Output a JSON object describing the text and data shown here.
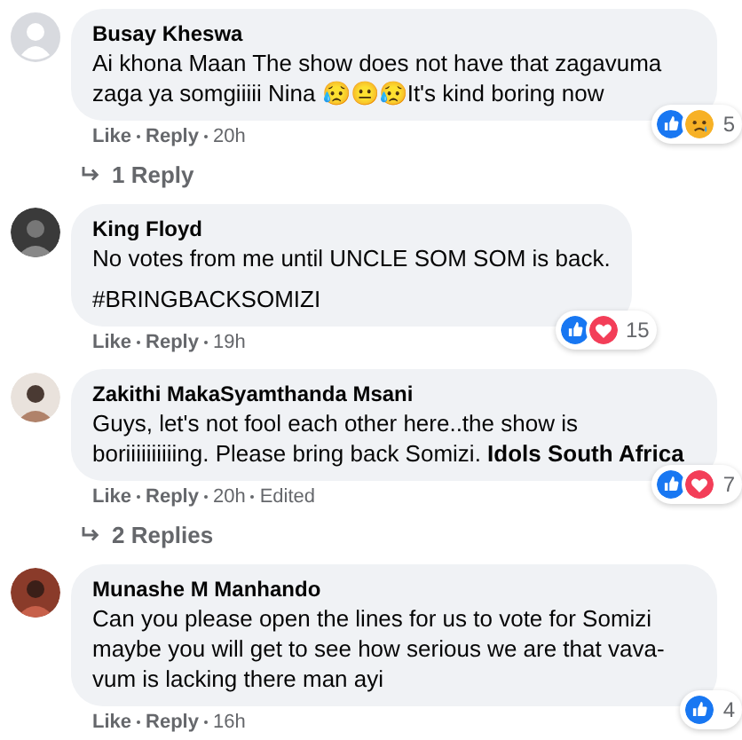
{
  "comments": [
    {
      "author": "Busay Kheswa",
      "avatar": {
        "has_photo": false
      },
      "paragraphs": [
        [
          {
            "kind": "text",
            "text": "Ai khona Maan The show does not have that zagavuma zaga ya somgiiiii Nina 😥😐😥It's kind boring now"
          }
        ]
      ],
      "reactions": {
        "like": true,
        "sad": true
      },
      "reaction_count": "5",
      "actions": [
        "Like",
        "Reply",
        "20h"
      ],
      "replies": "1 Reply"
    },
    {
      "author": "King Floyd",
      "avatar": {
        "has_photo": true
      },
      "paragraphs": [
        [
          {
            "kind": "text",
            "text": "No votes from me until UNCLE SOM SOM is back."
          }
        ],
        [
          {
            "kind": "hashtag",
            "text": "#BRINGBACKSOMIZI"
          }
        ]
      ],
      "reactions": {
        "like": true,
        "love": true
      },
      "reaction_count": "15",
      "actions": [
        "Like",
        "Reply",
        "19h"
      ]
    },
    {
      "author": "Zakithi MakaSyamthanda Msani",
      "avatar": {
        "has_photo": true
      },
      "paragraphs": [
        [
          {
            "kind": "text",
            "text": "Guys, let's not fool each other here..the show is boriiiiiiiiiing. Please bring back Somizi. "
          },
          {
            "kind": "link",
            "text": "Idols South Africa"
          }
        ]
      ],
      "reactions": {
        "like": true,
        "love": true
      },
      "reaction_count": "7",
      "actions": [
        "Like",
        "Reply",
        "20h",
        "Edited"
      ],
      "replies": "2 Replies"
    },
    {
      "author": "Munashe M Manhando",
      "avatar": {
        "has_photo": true
      },
      "paragraphs": [
        [
          {
            "kind": "text",
            "text": "Can you please open the lines for us to vote for Somizi maybe you will get to see how serious we are that vava-vum is lacking there man ayi"
          }
        ]
      ],
      "reactions": {
        "like": true
      },
      "reaction_count": "4",
      "actions": [
        "Like",
        "Reply",
        "16h"
      ]
    }
  ]
}
